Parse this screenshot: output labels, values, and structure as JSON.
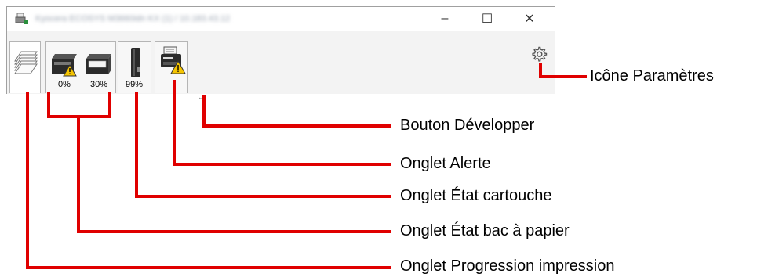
{
  "window": {
    "title": "Kyocera ECOSYS M3660idn KX (1) / 10.183.43.12",
    "controls": {
      "minimize": "–",
      "maximize": "☐",
      "close": "✕"
    },
    "tabs": {
      "tray_left_level": "0%",
      "tray_right_level": "30%",
      "toner_level": "99%"
    },
    "expand_symbol": "⌄"
  },
  "callouts": {
    "settings_icon": "Icône Paramètres",
    "expand_button": "Bouton Développer",
    "alert_tab": "Onglet Alerte",
    "toner_tab": "Onglet État cartouche",
    "paper_tray_tab": "Onglet État bac à papier",
    "print_progress_tab": "Onglet Progression impression"
  },
  "colors": {
    "callout_line": "#e00000",
    "warning_yellow": "#f5c400"
  }
}
